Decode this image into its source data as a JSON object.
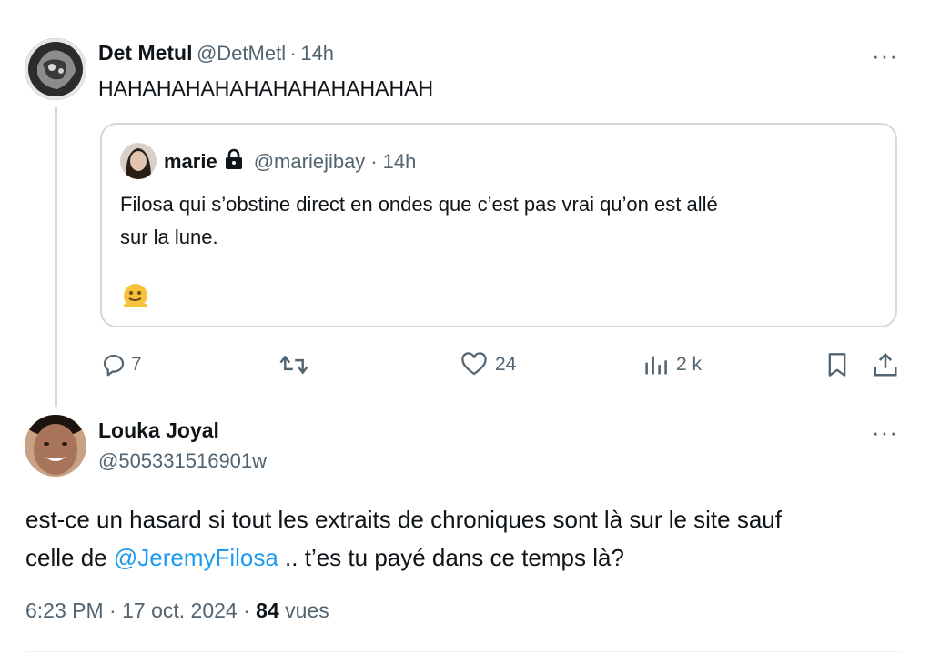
{
  "tweet1": {
    "name": "Det Metul",
    "handle": "@DetMetl",
    "dot": "·",
    "time": "14h",
    "text": "HAHAHAHAHAHAHAHAHAHAHAH",
    "more": "···"
  },
  "quote": {
    "name": "marie",
    "handle": "@mariejibay",
    "dot": "·",
    "time": "14h",
    "text_line1": "Filosa qui s’obstine direct en ondes que c’est pas vrai qu’on est allé",
    "text_line2": "sur la lune.",
    "emoji": "🫠"
  },
  "actions": {
    "replies": "7",
    "retweets": "",
    "likes": "24",
    "views": "2 k"
  },
  "tweet2": {
    "name": "Louka Joyal",
    "handle": "@505331516901w",
    "more": "···",
    "text_part1": "est-ce un hasard si tout les extraits de chroniques sont là sur le site sauf",
    "text_part2": "celle de ",
    "mention": "@JeremyFilosa",
    "text_part3": " .. t’es tu payé dans ce temps là?",
    "time": "6:23 PM",
    "dot": "·",
    "date": "17 oct. 2024",
    "dot2": "·",
    "views_count": "84",
    "views_label": " vues"
  },
  "colors": {
    "text": "#0f1419",
    "secondary": "#536471",
    "link": "#1d9bf0",
    "border": "#cfd9de"
  }
}
